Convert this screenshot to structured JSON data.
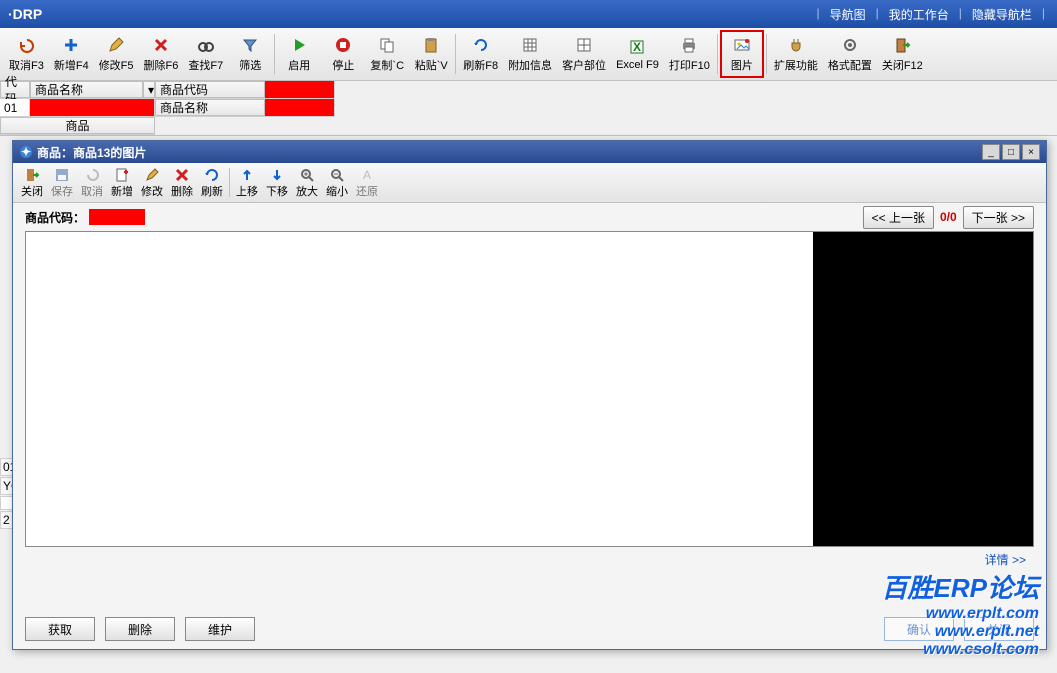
{
  "header": {
    "title": "·DRP",
    "links": {
      "nav": "导航图",
      "workbench": "我的工作台",
      "hide": "隐藏导航栏"
    }
  },
  "toolbar": {
    "cancel": "取消F3",
    "add": "新增F4",
    "edit": "修改F5",
    "del": "删除F6",
    "find": "查找F7",
    "filter": "筛选",
    "start": "启用",
    "stop": "停止",
    "copy": "复制`C",
    "paste": "粘贴`V",
    "refresh": "刷新F8",
    "addinfo": "附加信息",
    "custunit": "客户部位",
    "excel": "Excel F9",
    "print": "打印F10",
    "image": "图片",
    "ext": "扩展功能",
    "format": "格式配置",
    "close": "关闭F12"
  },
  "grid": {
    "col_code": "代码",
    "col_name": "商品名称",
    "row1_code": "01",
    "panel_code_lbl": "商品代码",
    "panel_name_lbl": "商品名称",
    "panel_code_val": "■■■■",
    "panel_name_val": "■■■■",
    "stub_item": "商品"
  },
  "side": {
    "r1": "01",
    "r2": "YG",
    "r3": "2"
  },
  "dialog": {
    "title": "商品：商品13的图片",
    "tb": {
      "close": "关闭",
      "save": "保存",
      "cancel": "取消",
      "add": "新增",
      "edit": "修改",
      "del": "删除",
      "refresh": "刷新",
      "up": "上移",
      "down": "下移",
      "zoomin": "放大",
      "zoomout": "缩小",
      "restore": "还原"
    },
    "code_label": "商品代码：",
    "code_value": "■ ■■■",
    "prev": "<< 上一张",
    "pager": "0/0",
    "next": "下一张 >>",
    "detail": "详情 >>",
    "get": "获取",
    "delete": "删除",
    "maintain": "维护",
    "confirm": "确认",
    "close_btn": "关闭"
  },
  "watermark": {
    "l1": "百胜ERP论坛",
    "l2a": "www.erplt.com",
    "l2b": "www.erplt.net",
    "l2c": "www.csolt.com"
  }
}
